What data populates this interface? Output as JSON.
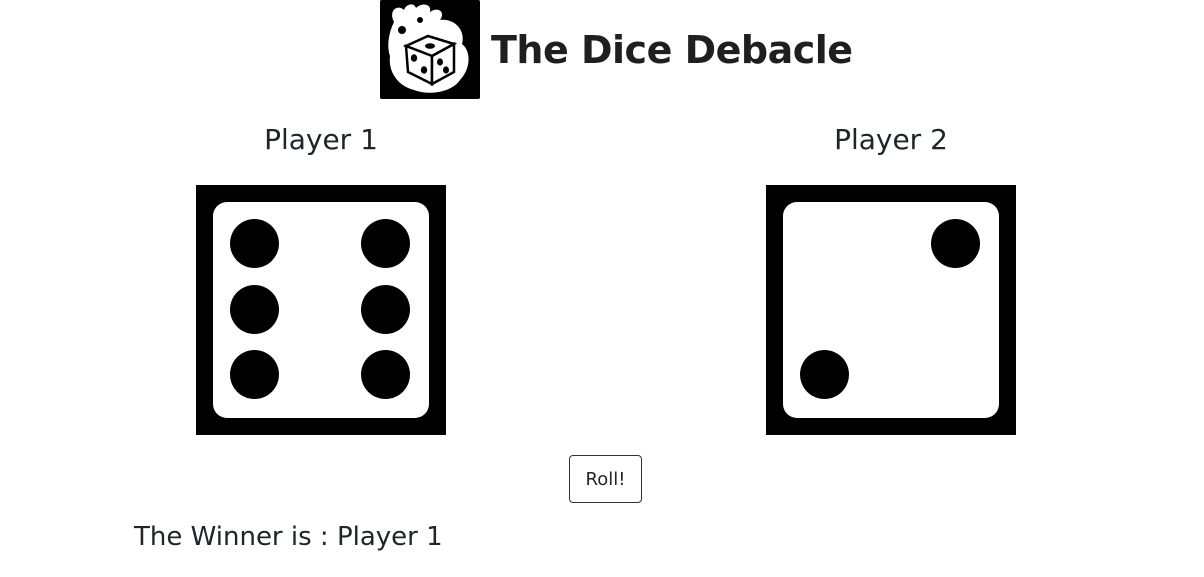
{
  "header": {
    "title": "The Dice Debacle",
    "logo_icon": "flaming-die-icon"
  },
  "players": [
    {
      "name": "Player 1",
      "die_value": 6
    },
    {
      "name": "Player 2",
      "die_value": 2
    }
  ],
  "controls": {
    "roll_label": "Roll!"
  },
  "result": {
    "winner_text": "The Winner is : Player 1"
  },
  "colors": {
    "die_background": "#000000",
    "die_face": "#ffffff",
    "pip": "#000000",
    "text": "#212529"
  }
}
